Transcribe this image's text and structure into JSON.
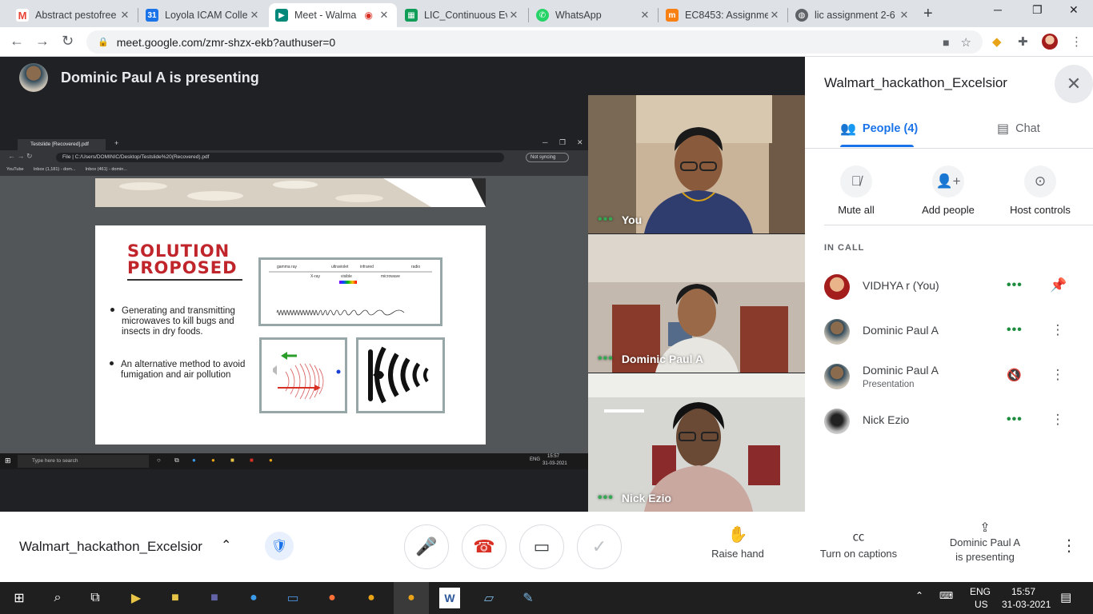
{
  "browser": {
    "tabs": [
      {
        "title": "Abstract pestofree",
        "icon": "gmail-icon",
        "color": "#ea4335"
      },
      {
        "title": "Loyola ICAM Colle",
        "icon": "calendar-icon",
        "color": "#1a73e8"
      },
      {
        "title": "Meet - Walma",
        "icon": "meet-icon",
        "color": "#00897b"
      },
      {
        "title": "LIC_Continuous Ev",
        "icon": "sheets-icon",
        "color": "#0f9d58"
      },
      {
        "title": "WhatsApp",
        "icon": "whatsapp-icon",
        "color": "#25d366"
      },
      {
        "title": "EC8453: Assignme",
        "icon": "moodle-icon",
        "color": "#f98012"
      },
      {
        "title": "lic assignment 2-6",
        "icon": "globe-icon",
        "color": "#5f6368"
      }
    ],
    "url": "meet.google.com/zmr-shzx-ekb?authuser=0"
  },
  "meet": {
    "presenter_banner": "Dominic Paul A is presenting",
    "meeting_name": "Walmart_hackathon_Excelsior",
    "tiles": [
      {
        "name": "You"
      },
      {
        "name": "Dominic Paul A"
      },
      {
        "name": "Nick Ezio"
      }
    ],
    "panel": {
      "title": "Walmart_hackathon_Excelsior",
      "tab_people": "People (4)",
      "tab_chat": "Chat",
      "actions": {
        "mute_all": "Mute all",
        "add_people": "Add people",
        "host_controls": "Host controls"
      },
      "in_call_label": "IN CALL",
      "participants": [
        {
          "name": "VIDHYA r (You)",
          "sub": ""
        },
        {
          "name": "Dominic Paul A",
          "sub": ""
        },
        {
          "name": "Dominic Paul A",
          "sub": "Presentation"
        },
        {
          "name": "Nick Ezio",
          "sub": ""
        }
      ]
    },
    "controls": {
      "raise_hand": "Raise hand",
      "captions": "Turn on captions",
      "presenting_line1": "Dominic Paul A",
      "presenting_line2": "is presenting"
    }
  },
  "shared_screen": {
    "tab_title": "Testslide [Recovered].pdf",
    "url": "File  |  C:/Users/DOMINIC/Desktop/Testslide%20(Recovered).pdf",
    "sync": "Not syncing",
    "bookmarks": "YouTube        Inbox (1,181) - dom...        Inbox (461) - domin...",
    "slide": {
      "title_line1": "SOLUTION",
      "title_line2": "PROPOSED",
      "bullet1": "Generating and transmitting microwaves to kill bugs and insects in dry foods.",
      "bullet2": "An alternative method to avoid fumigation and air pollution",
      "spectrum_labels": [
        "gamma ray",
        "X-ray",
        "ultraviolet",
        "visible",
        "infrared",
        "microwave",
        "radio"
      ]
    },
    "taskbar_search": "Type here to search",
    "taskbar_lang": "ENG",
    "taskbar_time": "15:57",
    "taskbar_date": "31-03-2021"
  },
  "taskbar": {
    "lang1": "ENG",
    "lang2": "US",
    "time": "15:57",
    "date": "31-03-2021"
  }
}
